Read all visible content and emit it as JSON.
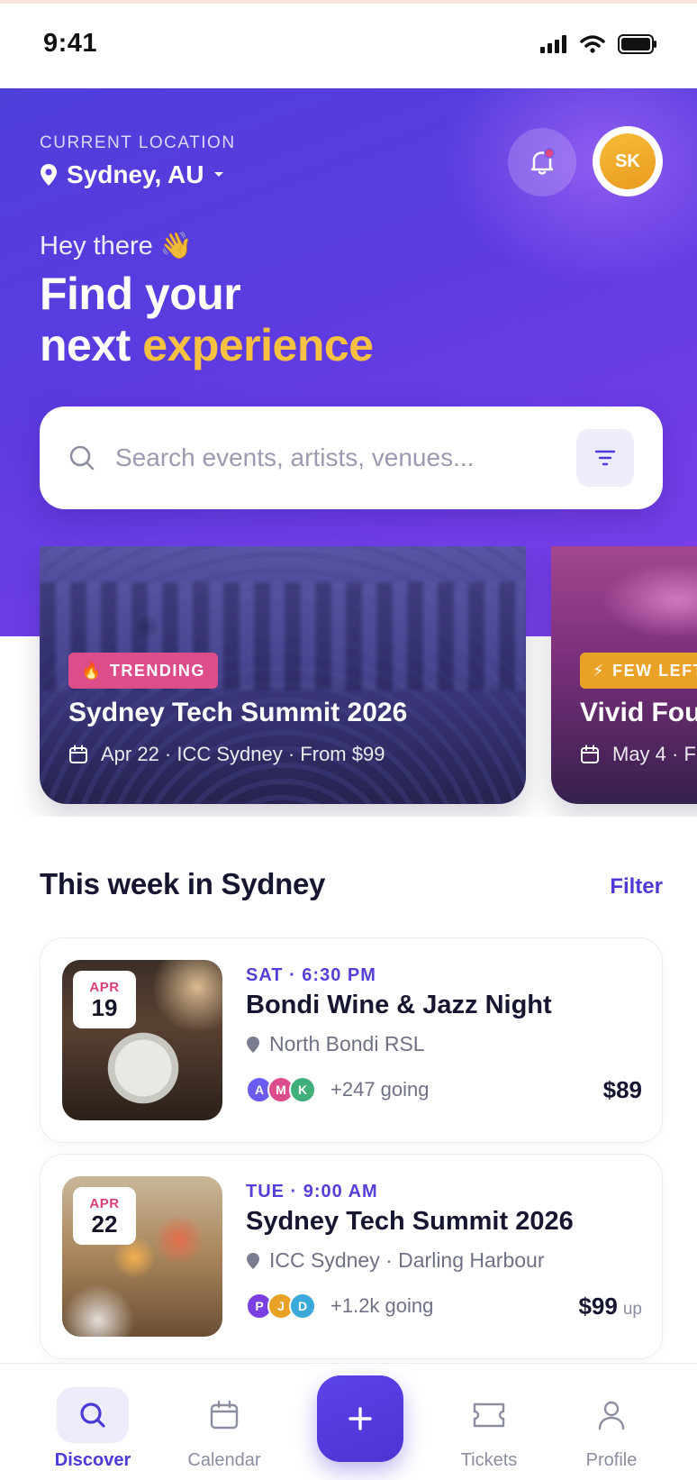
{
  "status_bar": {
    "time": "9:41"
  },
  "header": {
    "location_label": "CURRENT LOCATION",
    "location_value": "Sydney, AU",
    "avatar_initials": "SK",
    "greeting": "Hey there 👋",
    "headline_line1": "Find your",
    "headline_line2_prefix": "next",
    "headline_line2_accent": "experience"
  },
  "search": {
    "placeholder": "Search events, artists, venues..."
  },
  "featured": [
    {
      "badge": "TRENDING",
      "badge_icon": "🔥",
      "title": "Sydney Tech Summit 2026",
      "meta": "Apr 22 · ICC Sydney · From $99"
    },
    {
      "badge": "FEW LEFT",
      "badge_icon": "⚡",
      "title": "Vivid Fou",
      "meta": "May 4 · F"
    }
  ],
  "section": {
    "title": "This week in Sydney",
    "link": "Filter"
  },
  "events": [
    {
      "month": "APR",
      "day": "19",
      "time": "SAT · 6:30 PM",
      "title": "Bondi Wine & Jazz Night",
      "venue": "North Bondi RSL",
      "attendees": [
        "A",
        "M",
        "K"
      ],
      "going": "+247 going",
      "price": "$89",
      "price_suffix": ""
    },
    {
      "month": "APR",
      "day": "22",
      "time": "TUE · 9:00 AM",
      "title": "Sydney Tech Summit 2026",
      "venue": "ICC Sydney · Darling Harbour",
      "attendees": [
        "P",
        "J",
        "D"
      ],
      "going": "+1.2k going",
      "price": "$99",
      "price_suffix": "up"
    }
  ],
  "nav": {
    "discover": "Discover",
    "calendar": "Calendar",
    "tickets": "Tickets",
    "profile": "Profile"
  },
  "colors": {
    "accent": "#4b3ad6",
    "headline_accent": "#f6c143",
    "trending_badge": "#dc4d8a",
    "few_left_badge": "#e9a126",
    "avatar_a": "#6a5cf0",
    "avatar_m": "#db4d8c",
    "avatar_k": "#3fb07a",
    "avatar_p": "#7a3fe0",
    "avatar_j": "#e9a126",
    "avatar_d": "#3aa8d8"
  }
}
